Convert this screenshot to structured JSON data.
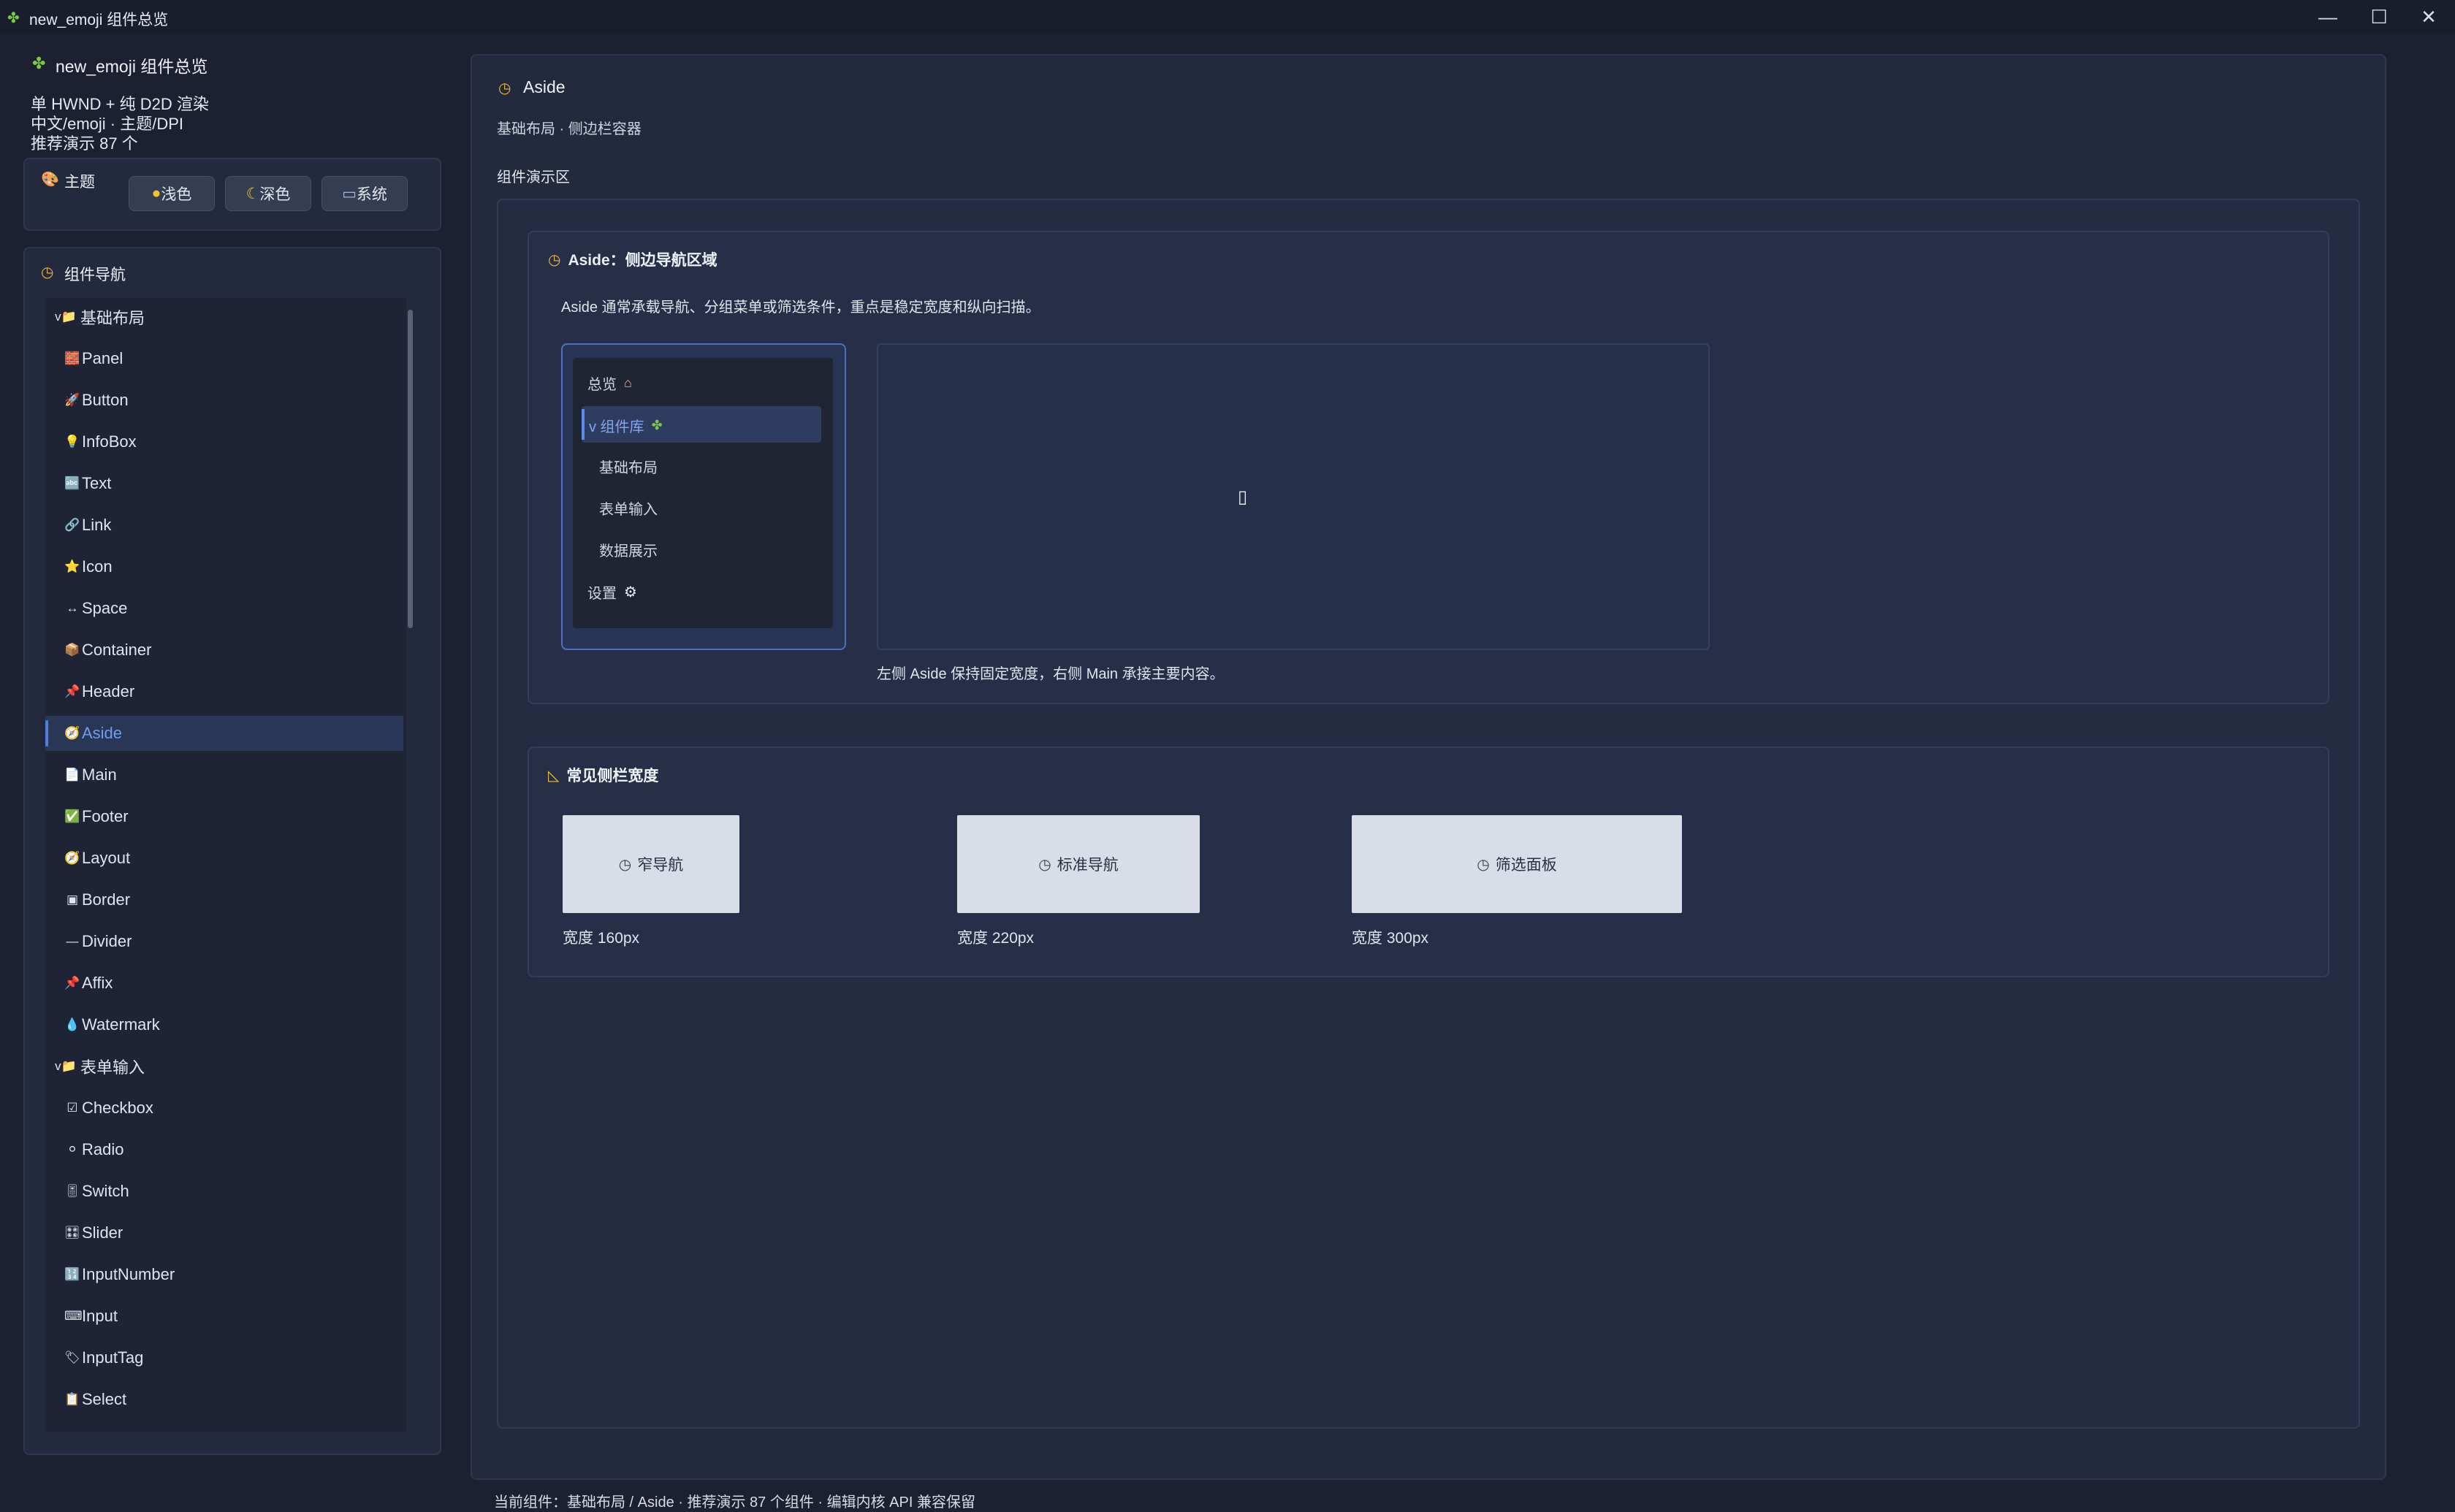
{
  "window": {
    "title": "new_emoji 组件总览",
    "icon": "puzzle-icon",
    "controls": [
      "minimize",
      "maximize",
      "close"
    ]
  },
  "sidebar": {
    "app_title": "new_emoji 组件总览",
    "info_lines": [
      "单 HWND + 纯 D2D 渲染",
      "中文/emoji · 主题/DPI",
      "推荐演示 87 个"
    ],
    "theme": {
      "title": "主题",
      "buttons": [
        {
          "icon": "🟡",
          "label": "浅色"
        },
        {
          "icon": "🌙",
          "label": "深色"
        },
        {
          "icon": "💻",
          "label": "系统"
        }
      ]
    },
    "nav": {
      "title": "组件导航",
      "items": [
        {
          "icon": "v📁",
          "label": "基础布局",
          "group": true
        },
        {
          "icon": "🧱",
          "label": "Panel"
        },
        {
          "icon": "🚀",
          "label": "Button"
        },
        {
          "icon": "💡",
          "label": "InfoBox"
        },
        {
          "icon": "🔤",
          "label": "Text"
        },
        {
          "icon": "🔗",
          "label": "Link"
        },
        {
          "icon": "⭐",
          "label": "Icon"
        },
        {
          "icon": "↔",
          "label": "Space"
        },
        {
          "icon": "📦",
          "label": "Container"
        },
        {
          "icon": "📌",
          "label": "Header"
        },
        {
          "icon": "🧭",
          "label": "Aside",
          "selected": true
        },
        {
          "icon": "📄",
          "label": "Main"
        },
        {
          "icon": "✅",
          "label": "Footer"
        },
        {
          "icon": "🧭",
          "label": "Layout"
        },
        {
          "icon": "▣",
          "label": "Border"
        },
        {
          "icon": "—",
          "label": "Divider"
        },
        {
          "icon": "📌",
          "label": "Affix"
        },
        {
          "icon": "💧",
          "label": "Watermark"
        },
        {
          "icon": "v📁",
          "label": "表单输入",
          "group": true
        },
        {
          "icon": "☑",
          "label": "Checkbox"
        },
        {
          "icon": "⚪",
          "label": "Radio"
        },
        {
          "icon": "🎚",
          "label": "Switch"
        },
        {
          "icon": "🎛",
          "label": "Slider"
        },
        {
          "icon": "🔢",
          "label": "InputNumber"
        },
        {
          "icon": "⌨",
          "label": "Input"
        },
        {
          "icon": "🏷",
          "label": "InputTag"
        },
        {
          "icon": "📋",
          "label": "Select"
        }
      ]
    }
  },
  "main": {
    "title": "Aside",
    "subtitle": "基础布局 · 侧边栏容器",
    "demo_area_label": "组件演示区",
    "section1": {
      "title": "Aside：侧边导航区域",
      "description": "Aside 通常承载导航、分组菜单或筛选条件，重点是稳定宽度和纵向扫描。",
      "menu": [
        {
          "label": "总览",
          "icon": "🏠"
        },
        {
          "label": "v 组件库",
          "icon": "🧩",
          "active": true
        },
        {
          "label": "基础布局",
          "sub": true
        },
        {
          "label": "表单输入",
          "sub": true
        },
        {
          "label": "数据展示",
          "sub": true
        },
        {
          "label": "设置",
          "icon": "⚙"
        }
      ],
      "main_placeholder_icon": "📄",
      "caption": "左侧 Aside 保持固定宽度，右侧 Main 承接主要内容。"
    },
    "section2": {
      "title": "常见侧栏宽度",
      "boxes": [
        {
          "label": "窄导航",
          "caption": "宽度 160px"
        },
        {
          "label": "标准导航",
          "caption": "宽度 220px"
        },
        {
          "label": "筛选面板",
          "caption": "宽度 300px"
        }
      ]
    }
  },
  "status_bar": {
    "text": "当前组件：基础布局 / Aside · 推荐演示 87 个组件 · 编辑内核 API 兼容保留"
  }
}
